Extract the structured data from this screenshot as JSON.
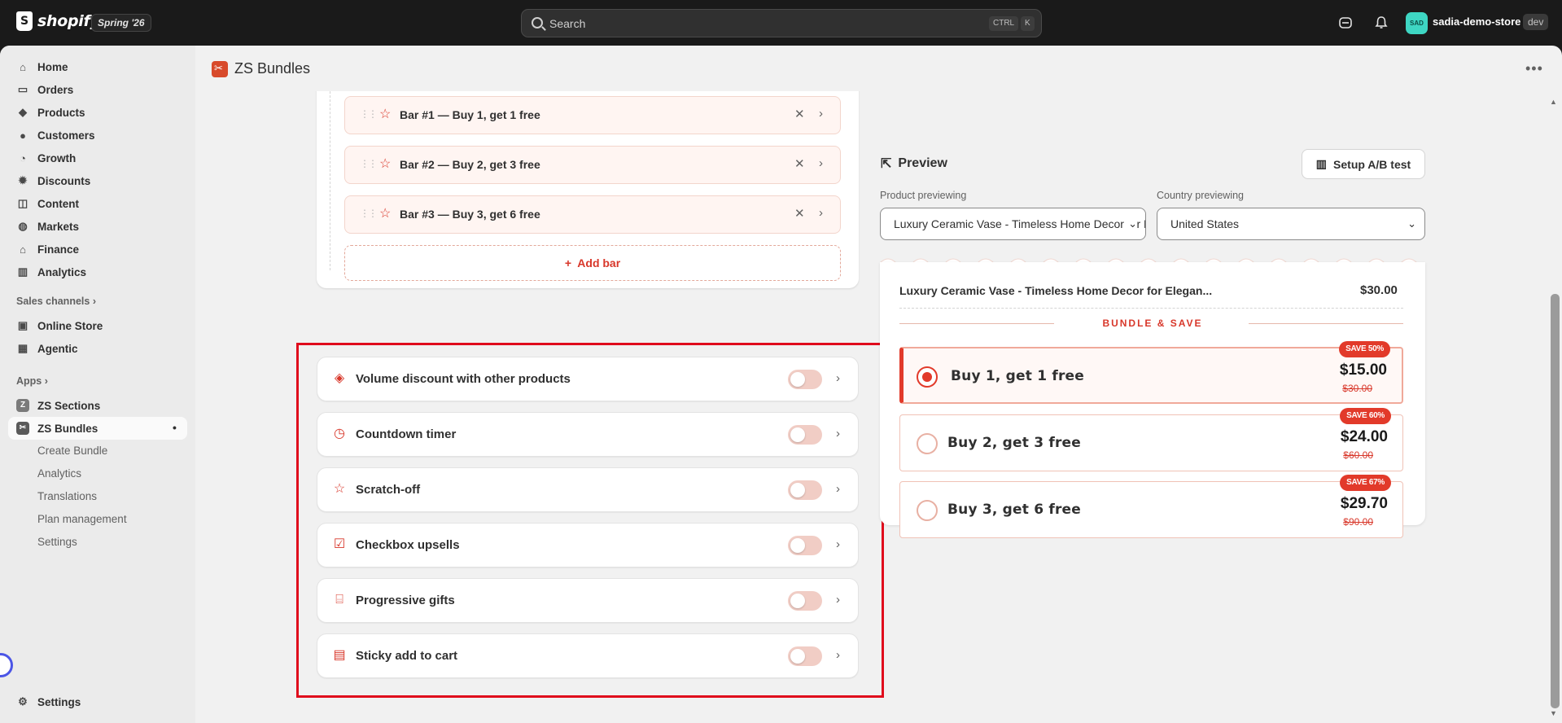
{
  "topbar": {
    "brand": "shopify",
    "edition": "Spring '26",
    "search_placeholder": "Search",
    "shortcut_ctrl": "CTRL",
    "shortcut_key": "K",
    "avatar_initials": "SAD",
    "store_name": "sadia-demo-store",
    "store_tag": "dev"
  },
  "sidebar": {
    "main_items": [
      {
        "label": "Home",
        "icon": "home-icon"
      },
      {
        "label": "Orders",
        "icon": "inbox-icon"
      },
      {
        "label": "Products",
        "icon": "tag-icon"
      },
      {
        "label": "Customers",
        "icon": "person-icon"
      },
      {
        "label": "Growth",
        "icon": "growth-icon"
      },
      {
        "label": "Discounts",
        "icon": "discount-icon"
      },
      {
        "label": "Content",
        "icon": "content-icon"
      },
      {
        "label": "Markets",
        "icon": "globe-icon"
      },
      {
        "label": "Finance",
        "icon": "bank-icon"
      },
      {
        "label": "Analytics",
        "icon": "bar-chart-icon"
      }
    ],
    "sales_channels_label": "Sales channels",
    "channels": [
      {
        "label": "Online Store",
        "icon": "store-icon"
      },
      {
        "label": "Agentic",
        "icon": "agentic-icon"
      }
    ],
    "apps_label": "Apps",
    "apps": [
      {
        "label": "ZS Sections"
      },
      {
        "label": "ZS Bundles"
      }
    ],
    "app_subitems": [
      "Create Bundle",
      "Analytics",
      "Translations",
      "Plan management",
      "Settings"
    ],
    "settings_label": "Settings"
  },
  "page": {
    "title": "ZS Bundles"
  },
  "bars": [
    {
      "label": "Bar #1 — Buy 1, get 1 free"
    },
    {
      "label": "Bar #2 — Buy 2, get 3 free"
    },
    {
      "label": "Bar #3 — Buy 3, get 6 free"
    }
  ],
  "add_bar_label": "Add bar",
  "features": [
    {
      "label": "Volume discount with other products",
      "icon": "layers-icon",
      "enabled": false
    },
    {
      "label": "Countdown timer",
      "icon": "clock-icon",
      "enabled": false
    },
    {
      "label": "Scratch-off",
      "icon": "star-icon",
      "enabled": false
    },
    {
      "label": "Checkbox upsells",
      "icon": "checkbox-icon",
      "enabled": false
    },
    {
      "label": "Progressive gifts",
      "icon": "gift-icon",
      "enabled": false
    },
    {
      "label": "Sticky add to cart",
      "icon": "window-icon",
      "enabled": false
    }
  ],
  "preview": {
    "title": "Preview",
    "ab_button": "Setup A/B test",
    "product_label": "Product previewing",
    "product_value": "Luxury Ceramic Vase - Timeless Home Decor for Elegant Living",
    "country_label": "Country previewing",
    "country_value": "United States",
    "widget_product": "Luxury Ceramic Vase - Timeless Home Decor for Elegan...",
    "widget_price": "$30.00",
    "bundle_heading": "BUNDLE & SAVE",
    "offers": [
      {
        "label": "Buy 1, get 1 free",
        "price": "$15.00",
        "old_price": "$30.00",
        "badge": "SAVE 50%",
        "selected": true
      },
      {
        "label": "Buy 2, get 3 free",
        "price": "$24.00",
        "old_price": "$60.00",
        "badge": "SAVE 60%",
        "selected": false
      },
      {
        "label": "Buy 3, get 6 free",
        "price": "$29.70",
        "old_price": "$90.00",
        "badge": "SAVE 67%",
        "selected": false
      }
    ]
  },
  "colors": {
    "accent": "#d8372a",
    "highlight_outline": "#e00b1c",
    "topbar": "#1a1a1a",
    "frame": "#f1f1f1"
  }
}
